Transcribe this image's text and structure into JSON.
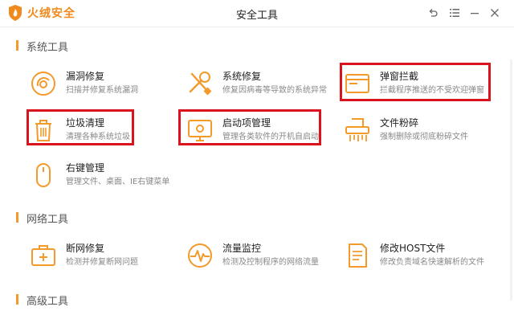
{
  "app": {
    "name": "火绒安全",
    "window_title": "安全工具",
    "accent": "#f39a2b",
    "highlight": "#d9141e"
  },
  "sections": {
    "system": "系统工具",
    "network": "网络工具",
    "advanced": "高级工具"
  },
  "tools": {
    "leak_fix": {
      "name": "漏洞修复",
      "desc": "扫描并修复系统漏洞",
      "icon": "shield-scan-icon"
    },
    "sys_repair": {
      "name": "系统修复",
      "desc": "修复因病毒等导致的系统异常",
      "icon": "wrench-screwdriver-icon"
    },
    "popup_block": {
      "name": "弹窗拦截",
      "desc": "拦截程序推送的不受欢迎弹窗",
      "icon": "browser-window-icon"
    },
    "junk_clean": {
      "name": "垃圾清理",
      "desc": "清理各种系统垃圾",
      "icon": "trash-icon"
    },
    "startup_mgr": {
      "name": "启动项管理",
      "desc": "管理各类软件的开机自启动",
      "icon": "monitor-icon"
    },
    "file_shred": {
      "name": "文件粉碎",
      "desc": "强制删除或彻底粉碎文件",
      "icon": "shredder-icon"
    },
    "right_menu": {
      "name": "右键管理",
      "desc": "管理文件、桌面、IE右键菜单",
      "icon": "mouse-icon"
    },
    "net_repair": {
      "name": "断网修复",
      "desc": "检测并修复断网问题",
      "icon": "medkit-icon"
    },
    "traffic_mon": {
      "name": "流量监控",
      "desc": "检测及控制程序的网络流量",
      "icon": "pulse-icon"
    },
    "host_edit": {
      "name": "修改HOST文件",
      "desc": "修改负责域名快速解析的文件",
      "icon": "document-icon"
    }
  }
}
